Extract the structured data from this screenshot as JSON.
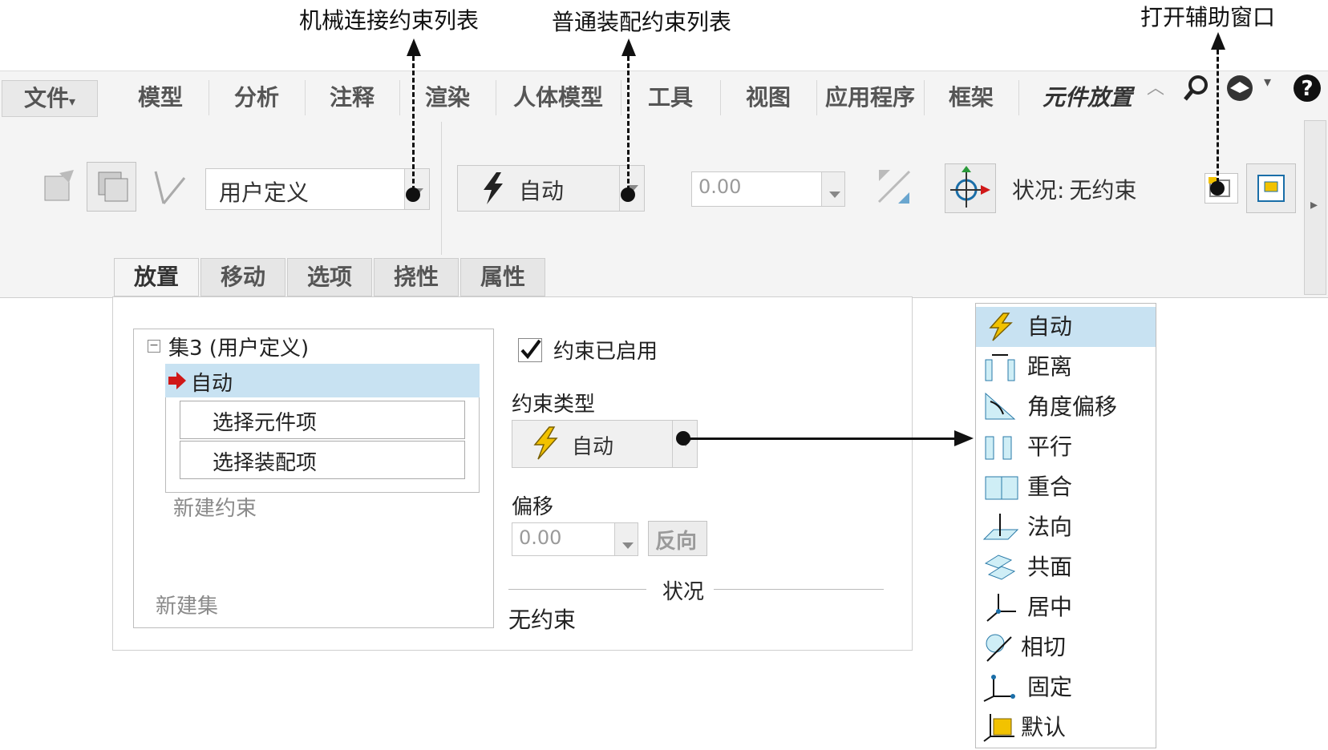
{
  "callouts": {
    "mechanical": "机械连接约束列表",
    "general": "普通装配约束列表",
    "aux_window": "打开辅助窗口"
  },
  "tabs": [
    "文件",
    "模型",
    "分析",
    "注释",
    "渲染",
    "人体模型",
    "工具",
    "视图",
    "应用程序",
    "框架",
    "元件放置"
  ],
  "toolbar": {
    "connection_type": "用户定义",
    "constraint_type": "自动",
    "offset_value": "0.00",
    "status_label": "状况:",
    "status_value": "无约束"
  },
  "subtabs": [
    "放置",
    "移动",
    "选项",
    "挠性",
    "属性"
  ],
  "tree": {
    "set_label": "集3 (用户定义)",
    "selected": "自动",
    "pick_component": "选择元件项",
    "pick_assembly": "选择装配项",
    "new_constraint": "新建约束",
    "new_set": "新建集"
  },
  "props": {
    "enabled_label": "约束已启用",
    "type_label": "约束类型",
    "type_value": "自动",
    "offset_label": "偏移",
    "offset_value": "0.00",
    "flip_label": "反向",
    "status_header": "状况",
    "status_value": "无约束"
  },
  "constraint_list": [
    "自动",
    "距离",
    "角度偏移",
    "平行",
    "重合",
    "法向",
    "共面",
    "居中",
    "相切",
    "固定",
    "默认"
  ],
  "colors": {
    "selection": "#c8e2f2",
    "accent": "#1a6ea8",
    "bolt": "#f2c200",
    "arrow_red": "#d01818"
  }
}
